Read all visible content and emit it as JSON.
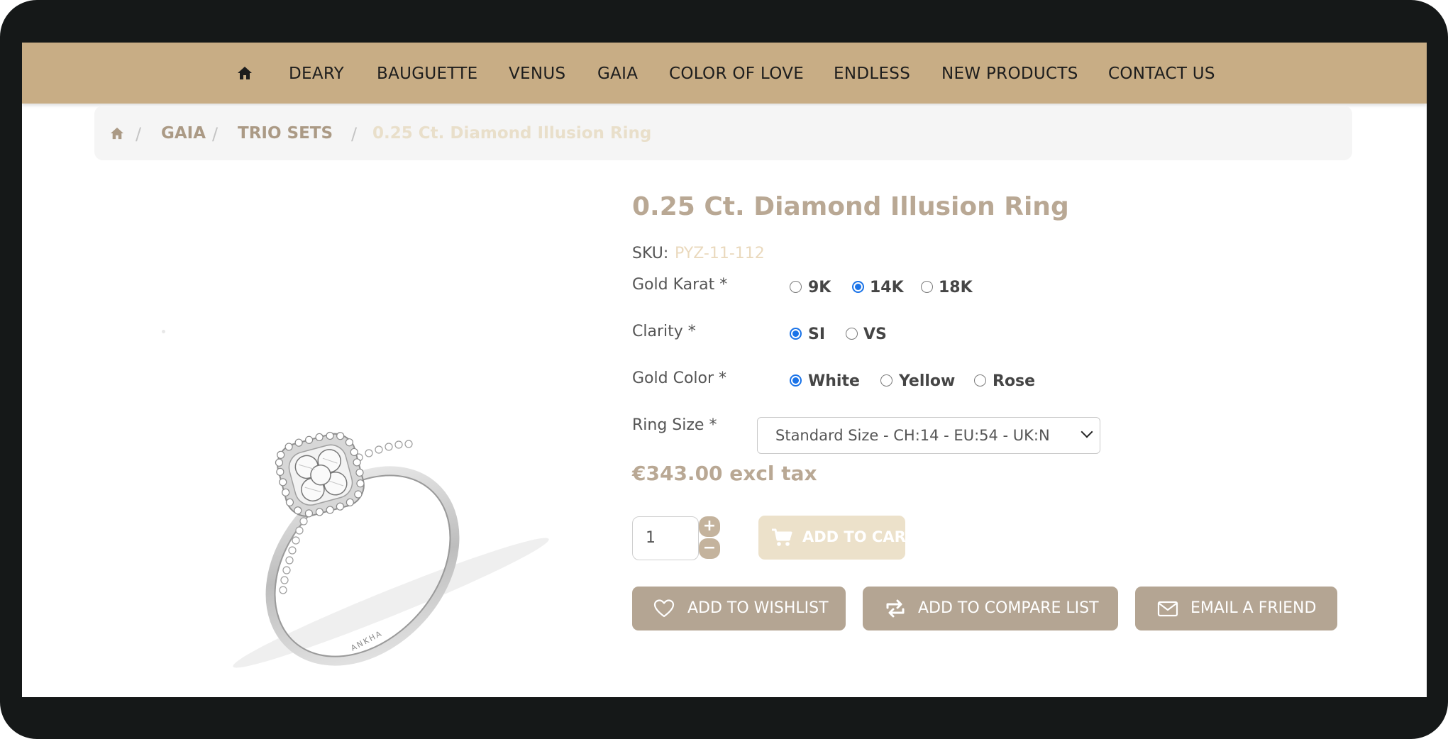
{
  "nav": {
    "home_icon": "home-icon",
    "items": [
      "DEARY",
      "BAUGUETTE",
      "VENUS",
      "GAIA",
      "COLOR OF LOVE",
      "ENDLESS",
      "NEW PRODUCTS",
      "CONTACT US"
    ]
  },
  "breadcrumb": {
    "home_icon": "home-icon",
    "separator": "/",
    "items": [
      "GAIA",
      "TRIO SETS"
    ],
    "current": "0.25 Ct. Diamond Illusion Ring"
  },
  "product": {
    "title": "0.25 Ct. Diamond Illusion Ring",
    "sku_label": "SKU:",
    "sku": "PYZ-11-112",
    "brand_engraving": "ANKHA",
    "options": {
      "gold_karat": {
        "label": "Gold Karat",
        "required_mark": "*",
        "choices": [
          "9K",
          "14K",
          "18K"
        ],
        "selected": "14K"
      },
      "clarity": {
        "label": "Clarity",
        "required_mark": "*",
        "choices": [
          "SI",
          "VS"
        ],
        "selected": "SI"
      },
      "gold_color": {
        "label": "Gold Color",
        "required_mark": "*",
        "choices": [
          "White",
          "Yellow",
          "Rose"
        ],
        "selected": "White"
      },
      "ring_size": {
        "label": "Ring Size",
        "required_mark": "*",
        "selected": "Standard Size - CH:14 - EU:54 - UK:N"
      }
    },
    "price": "€343.00 excl tax",
    "quantity": "1",
    "qty_plus": "+",
    "qty_minus": "−",
    "add_to_cart": "ADD TO CART",
    "actions": {
      "wishlist": "ADD TO WISHLIST",
      "compare": "ADD TO COMPARE LIST",
      "email": "EMAIL A FRIEND"
    }
  },
  "colors": {
    "nav_bg": "#c8ad85",
    "accent": "#b9a894",
    "button_bg": "#b4a593",
    "cart_disabled_bg": "#ece1ca",
    "radio_checked": "#1a73e8"
  }
}
